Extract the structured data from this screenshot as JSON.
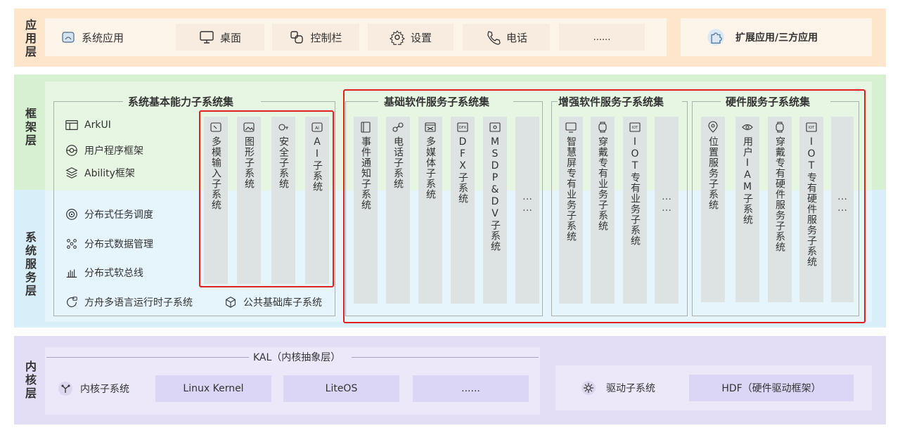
{
  "layers": {
    "app": [
      "应",
      "用",
      "层"
    ],
    "framework": [
      "框",
      "架",
      "层"
    ],
    "system_service": [
      "系",
      "统",
      "服",
      "务",
      "层"
    ],
    "kernel": [
      "内",
      "核",
      "层"
    ]
  },
  "app_layer": {
    "items": [
      {
        "label": "系统应用",
        "icon": "app-window-icon"
      },
      {
        "label": "桌面",
        "icon": "monitor-icon"
      },
      {
        "label": "控制栏",
        "icon": "control-bar-icon"
      },
      {
        "label": "设置",
        "icon": "gear-icon"
      },
      {
        "label": "电话",
        "icon": "phone-icon"
      },
      {
        "label": "......",
        "icon": ""
      }
    ],
    "extension": {
      "label": "扩展应用/三方应用",
      "icon": "puzzle-icon"
    }
  },
  "basic_capability": {
    "title": "系统基本能力子系统集",
    "framework_items": [
      {
        "label": "ArkUI",
        "icon": "ui-layout-icon"
      },
      {
        "label": "用户程序框架",
        "icon": "program-framework-icon"
      },
      {
        "label": "Ability框架",
        "icon": "layers-icon"
      }
    ],
    "service_items": [
      {
        "label": "分布式任务调度",
        "icon": "task-schedule-icon"
      },
      {
        "label": "分布式数据管理",
        "icon": "data-management-icon"
      },
      {
        "label": "分布式软总线",
        "icon": "softbus-icon"
      }
    ],
    "bottom_items": [
      {
        "label": "方舟多语言运行时子系统",
        "icon": "runtime-icon"
      },
      {
        "label": "公共基础库子系统",
        "icon": "cube-icon"
      }
    ],
    "columns": [
      {
        "label": "多模输入子系统",
        "icon": "input-icon"
      },
      {
        "label": "图形子系统",
        "icon": "image-icon"
      },
      {
        "label": "安全子系统",
        "icon": "key-icon"
      },
      {
        "label": "AI子系统",
        "icon": "ai-icon"
      }
    ]
  },
  "basic_software": {
    "title": "基础软件服务子系统集",
    "columns": [
      {
        "label": "事件通知子系统",
        "icon": "notification-icon"
      },
      {
        "label": "电话子系统",
        "icon": "telephony-icon"
      },
      {
        "label": "多媒体子系统",
        "icon": "media-icon"
      },
      {
        "label": "DFX子系统",
        "icon": "dfx-icon"
      },
      {
        "label": "MSDP&DV子系统",
        "icon": "msdp-icon"
      },
      {
        "label": "……",
        "icon": ""
      }
    ]
  },
  "enhanced_software": {
    "title": "增强软件服务子系统集",
    "columns": [
      {
        "label": "智慧屏专有业务子系统",
        "icon": "smart-screen-icon"
      },
      {
        "label": "穿戴专有业务子系统",
        "icon": "watch-icon"
      },
      {
        "label": "IOT专有业务子系统",
        "icon": "iot-icon"
      },
      {
        "label": "……",
        "icon": ""
      }
    ]
  },
  "hardware_service": {
    "title": "硬件服务子系统集",
    "columns": [
      {
        "label": "位置服务子系统",
        "icon": "location-icon"
      },
      {
        "label": "用户IAM子系统",
        "icon": "eye-icon"
      },
      {
        "label": "穿戴专有硬件服务子系统",
        "icon": "watch-icon"
      },
      {
        "label": "IOT专有硬件服务子系统",
        "icon": "iot-icon"
      },
      {
        "label": "……",
        "icon": ""
      }
    ]
  },
  "kernel_layer": {
    "kal_label": "KAL（内核抽象层）",
    "subsystem_label": "内核子系统",
    "items": [
      "Linux Kernel",
      "LiteOS",
      "......"
    ],
    "driver_label": "驱动子系统",
    "hdf_label": "HDF（硬件驱动框架）"
  }
}
